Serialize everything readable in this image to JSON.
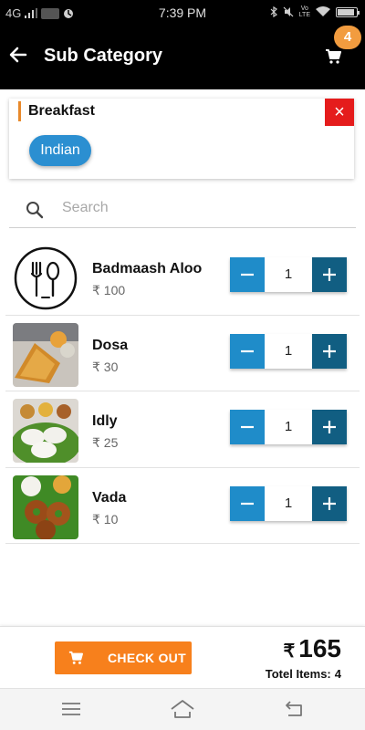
{
  "status_bar": {
    "network": "4G",
    "time": "7:39 PM",
    "battery_level": 0.9,
    "icons": [
      "signal-icon",
      "sync-icon",
      "bluetooth-icon",
      "mute-icon",
      "volte-icon",
      "wifi-icon",
      "battery-icon"
    ]
  },
  "app_bar": {
    "title": "Sub Category",
    "cart_count": "4"
  },
  "category": {
    "title": "Breakfast",
    "close_label": "×",
    "chips": [
      "Indian"
    ]
  },
  "search": {
    "placeholder": "Search",
    "value": ""
  },
  "currency": "₹",
  "products": [
    {
      "name": "Badmaash Aloo",
      "price": "₹ 100",
      "quantity": "1",
      "image": "cutlery-logo"
    },
    {
      "name": "Dosa",
      "price": "₹ 30",
      "quantity": "1",
      "image": "dosa-photo"
    },
    {
      "name": "Idly",
      "price": "₹ 25",
      "quantity": "1",
      "image": "idly-photo"
    },
    {
      "name": "Vada",
      "price": "₹ 10",
      "quantity": "1",
      "image": "vada-photo"
    }
  ],
  "footer": {
    "checkout_label": "CHECK OUT",
    "total": "165",
    "total_items_label": "Totel Items:",
    "total_items_count": "4"
  },
  "colors": {
    "accent_orange": "#f7801c",
    "badge_orange": "#f29c3f",
    "chip_blue": "#2b8fd1",
    "minus_blue": "#1f8cc9",
    "plus_blue": "#115e82",
    "close_red": "#e51c1c"
  }
}
